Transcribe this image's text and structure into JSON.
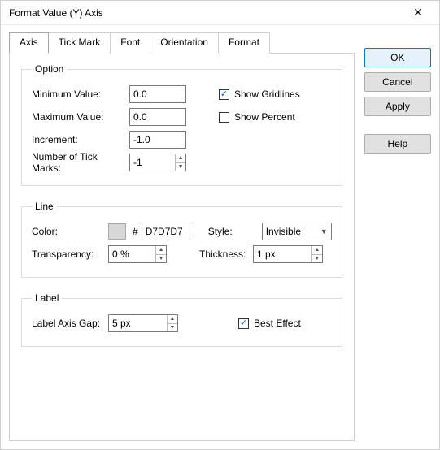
{
  "title": "Format Value (Y) Axis",
  "tabs": [
    "Axis",
    "Tick Mark",
    "Font",
    "Orientation",
    "Format"
  ],
  "activeTab": 0,
  "buttons": {
    "ok": "OK",
    "cancel": "Cancel",
    "apply": "Apply",
    "help": "Help"
  },
  "group_option": {
    "legend": "Option",
    "minimum_label": "Minimum Value:",
    "minimum_value": "0.0",
    "show_gridlines_label": "Show Gridlines",
    "show_gridlines_checked": true,
    "maximum_label": "Maximum Value:",
    "maximum_value": "0.0",
    "show_percent_label": "Show Percent",
    "show_percent_checked": false,
    "increment_label": "Increment:",
    "increment_value": "-1.0",
    "tickmarks_label": "Number of Tick Marks:",
    "tickmarks_value": "-1"
  },
  "group_line": {
    "legend": "Line",
    "color_label": "Color:",
    "color_hex": "D7D7D7",
    "style_label": "Style:",
    "style_value": "Invisible",
    "transparency_label": "Transparency:",
    "transparency_value": "0 %",
    "thickness_label": "Thickness:",
    "thickness_value": "1 px"
  },
  "group_label": {
    "legend": "Label",
    "gap_label": "Label Axis Gap:",
    "gap_value": "5 px",
    "best_effect_label": "Best Effect",
    "best_effect_checked": true
  }
}
